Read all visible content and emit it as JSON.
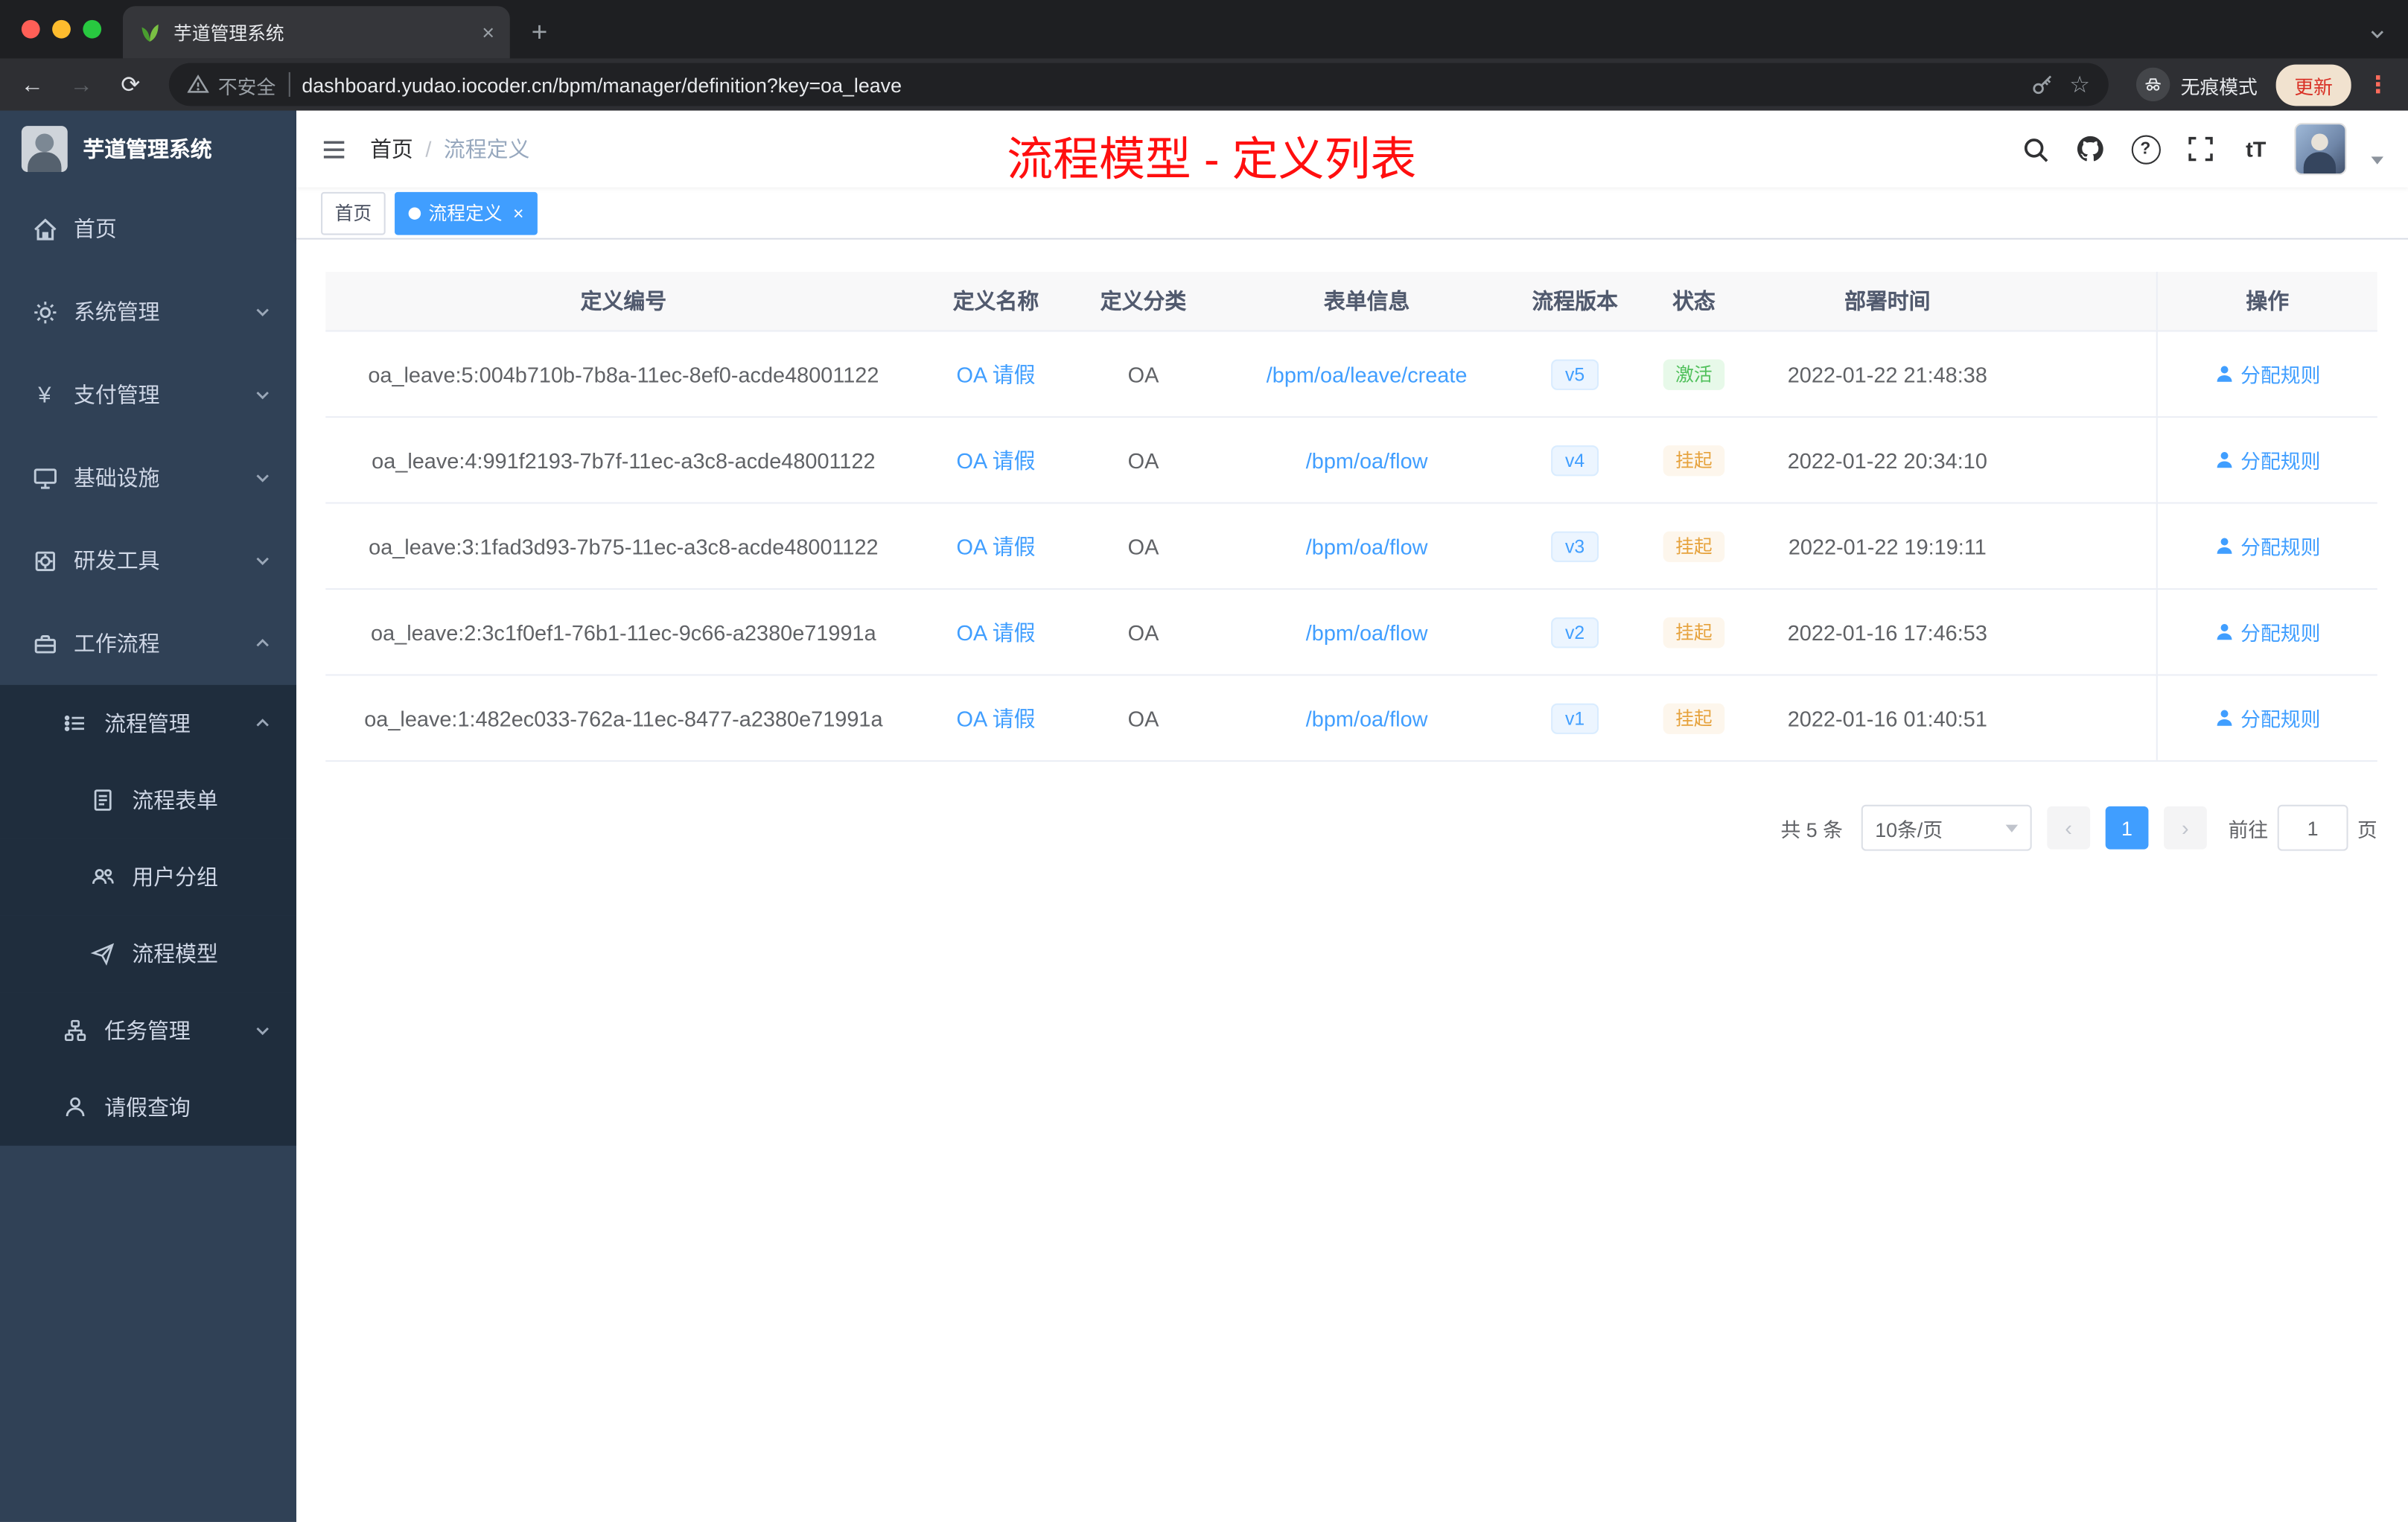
{
  "browser": {
    "tab": {
      "title": "芋道管理系统",
      "favicon": "sprout-icon"
    },
    "security_label": "不安全",
    "url": "dashboard.yudao.iocoder.cn/bpm/manager/definition?key=oa_leave",
    "incognito_label": "无痕模式",
    "update_label": "更新"
  },
  "sidebar": {
    "logo_title": "芋道管理系统",
    "items": [
      {
        "icon": "home-icon",
        "label": "首页",
        "depth": 1
      },
      {
        "icon": "gear-icon",
        "label": "系统管理",
        "depth": 1,
        "chevron": "down"
      },
      {
        "icon": "yen-icon",
        "label": "支付管理",
        "depth": 1,
        "chevron": "down"
      },
      {
        "icon": "infrastructure-icon",
        "label": "基础设施",
        "depth": 1,
        "chevron": "down"
      },
      {
        "icon": "dev-tools-icon",
        "label": "研发工具",
        "depth": 1,
        "chevron": "down"
      },
      {
        "icon": "workflow-icon",
        "label": "工作流程",
        "depth": 1,
        "chevron": "up"
      },
      {
        "icon": "process-manage-icon",
        "label": "流程管理",
        "depth": 2,
        "chevron": "up"
      },
      {
        "icon": "form-icon",
        "label": "流程表单",
        "depth": 3
      },
      {
        "icon": "user-group-icon",
        "label": "用户分组",
        "depth": 3
      },
      {
        "icon": "process-model-icon",
        "label": "流程模型",
        "depth": 3
      },
      {
        "icon": "task-manage-icon",
        "label": "任务管理",
        "depth": 2,
        "chevron": "down"
      },
      {
        "icon": "leave-query-icon",
        "label": "请假查询",
        "depth": 2
      }
    ]
  },
  "header": {
    "breadcrumb": {
      "root": "首页",
      "separator": "/",
      "current": "流程定义"
    },
    "annotation": "流程模型 - 定义列表",
    "icons": [
      "search-icon",
      "github-icon",
      "question-icon",
      "fullscreen-icon",
      "font-size-icon",
      "avatar"
    ],
    "font_size_icon_glyph": "tT"
  },
  "tags": {
    "items": [
      {
        "label": "首页",
        "active": false
      },
      {
        "label": "流程定义",
        "active": true,
        "closable": true
      }
    ]
  },
  "table": {
    "columns": [
      "定义编号",
      "定义名称",
      "定义分类",
      "表单信息",
      "流程版本",
      "状态",
      "部署时间",
      "操作"
    ],
    "rows": [
      {
        "id": "oa_leave:5:004b710b-7b8a-11ec-8ef0-acde48001122",
        "name": "OA 请假",
        "category": "OA",
        "form": "/bpm/oa/leave/create",
        "version": "v5",
        "status": "激活",
        "status_type": "success",
        "time": "2022-01-22 21:48:38",
        "action": "分配规则"
      },
      {
        "id": "oa_leave:4:991f2193-7b7f-11ec-a3c8-acde48001122",
        "name": "OA 请假",
        "category": "OA",
        "form": "/bpm/oa/flow",
        "version": "v4",
        "status": "挂起",
        "status_type": "warning",
        "time": "2022-01-22 20:34:10",
        "action": "分配规则"
      },
      {
        "id": "oa_leave:3:1fad3d93-7b75-11ec-a3c8-acde48001122",
        "name": "OA 请假",
        "category": "OA",
        "form": "/bpm/oa/flow",
        "version": "v3",
        "status": "挂起",
        "status_type": "warning",
        "time": "2022-01-22 19:19:11",
        "action": "分配规则"
      },
      {
        "id": "oa_leave:2:3c1f0ef1-76b1-11ec-9c66-a2380e71991a",
        "name": "OA 请假",
        "category": "OA",
        "form": "/bpm/oa/flow",
        "version": "v2",
        "status": "挂起",
        "status_type": "warning",
        "time": "2022-01-16 17:46:53",
        "action": "分配规则"
      },
      {
        "id": "oa_leave:1:482ec033-762a-11ec-8477-a2380e71991a",
        "name": "OA 请假",
        "category": "OA",
        "form": "/bpm/oa/flow",
        "version": "v1",
        "status": "挂起",
        "status_type": "warning",
        "time": "2022-01-16 01:40:51",
        "action": "分配规则"
      }
    ]
  },
  "pagination": {
    "total": "共 5 条",
    "page_size": "10条/页",
    "prev": "‹",
    "current_page": "1",
    "next": "›",
    "goto_label": "前往",
    "goto_value": "1",
    "unit_label": "页"
  },
  "colors": {
    "accent": "#409eff",
    "success": "#4fc05a",
    "warning": "#e6a23c",
    "annotation_red": "#ff0f0f",
    "sidebar_bg": "#304156",
    "submenu_bg": "#1f2d3d",
    "browser_dark": "#202124"
  }
}
